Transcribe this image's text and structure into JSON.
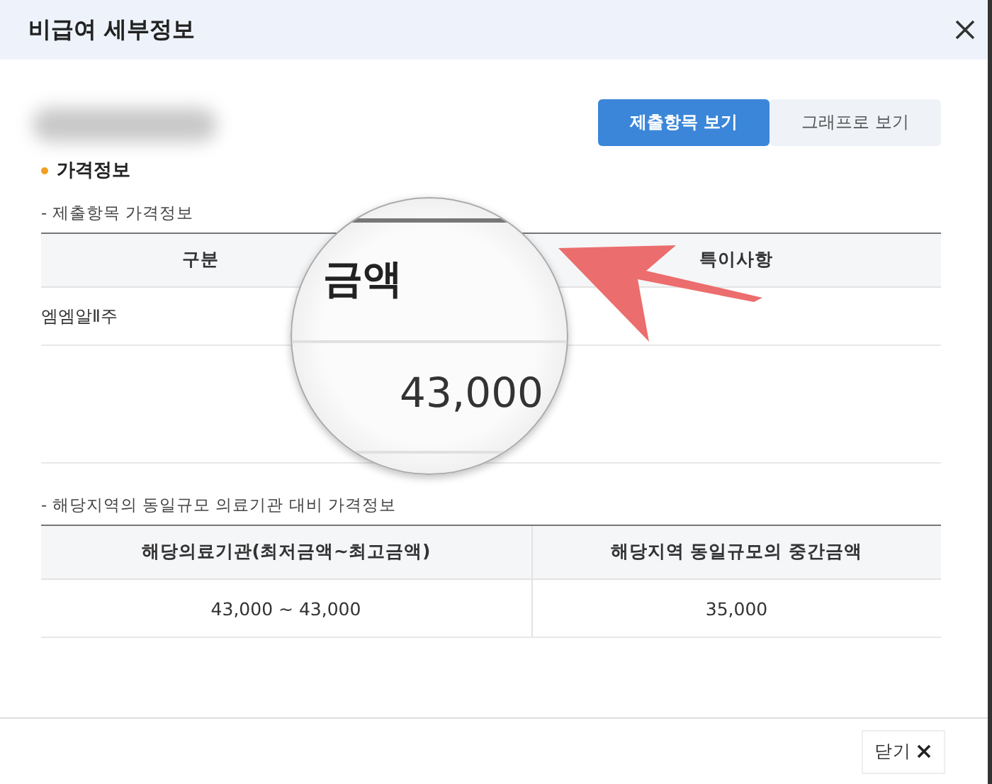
{
  "window": {
    "title": "비급여 세부정보"
  },
  "views": [
    {
      "label": "제출항목 보기",
      "selected": true
    },
    {
      "label": "그래프로 보기",
      "selected": false
    }
  ],
  "section": {
    "title": "가격정보"
  },
  "submitted": {
    "caption": "- 제출항목 가격정보",
    "columns": [
      "구분",
      "특이사항"
    ],
    "rows": [
      {
        "item": "엠엠알Ⅱ주"
      }
    ]
  },
  "magnifier": {
    "heading": "금액",
    "value": "43,000"
  },
  "regional": {
    "caption": "- 해당지역의 동일규모 의료기관 대비 가격정보",
    "columns": [
      "해당의료기관(최저금액~최고금액)",
      "해당지역 동일규모의 중간금액"
    ],
    "rows": [
      [
        "43,000 ~ 43,000",
        "35,000"
      ]
    ]
  },
  "footer": {
    "close_label": "닫기"
  }
}
